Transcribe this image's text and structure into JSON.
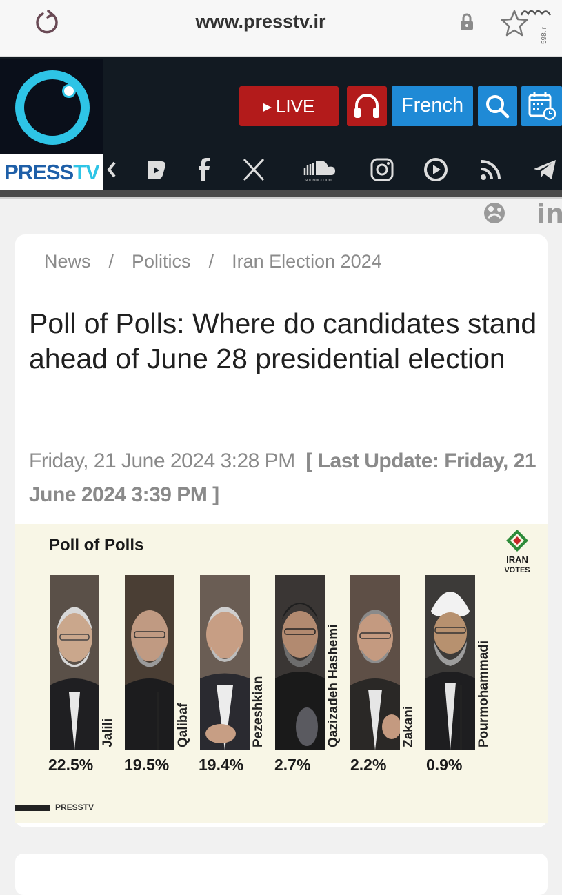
{
  "browser": {
    "url": "www.presstv.ir",
    "watermark_text": "598.ir"
  },
  "header": {
    "logo_text_press": "PRESS",
    "logo_text_tv": "TV",
    "live_label": "LIVE",
    "language_label": "French",
    "social_icons": [
      "previous-arrow-icon",
      "rumble-icon",
      "facebook-icon",
      "x-icon",
      "soundcloud-icon",
      "instagram-icon",
      "odysee-icon",
      "rss-icon",
      "telegram-icon"
    ],
    "soundcloud_label": "SOUNDCLOUD"
  },
  "util": {
    "linkedin": "in"
  },
  "article": {
    "breadcrumb": [
      "News",
      "Politics",
      "Iran Election 2024"
    ],
    "breadcrumb_sep": "/",
    "title": "Poll of Polls: Where do candidates stand ahead of June 28 presidential election",
    "published": "Friday, 21 June 2024 3:28 PM",
    "last_update": "[ Last Update: Friday, 21 June 2024 3:39 PM ]"
  },
  "infographic": {
    "title": "Poll of Polls",
    "badge_line1": "IRAN",
    "badge_line2": "VOTES",
    "footer": "PRESSTV",
    "candidates": [
      {
        "name": "Jalili",
        "percent": "22.5%"
      },
      {
        "name": "Qalibaf",
        "percent": "19.5%"
      },
      {
        "name": "Pezeshkian",
        "percent": "19.4%"
      },
      {
        "name": "Qazizadeh Hashemi",
        "percent": "2.7%"
      },
      {
        "name": "Zakani",
        "percent": "2.2%"
      },
      {
        "name": "Pourmohammadi",
        "percent": "0.9%"
      }
    ]
  },
  "colors": {
    "live_red": "#b31b1b",
    "brand_blue": "#1f8ad6",
    "logo_cyan": "#2ec4e6",
    "header_dark": "#121a22"
  }
}
